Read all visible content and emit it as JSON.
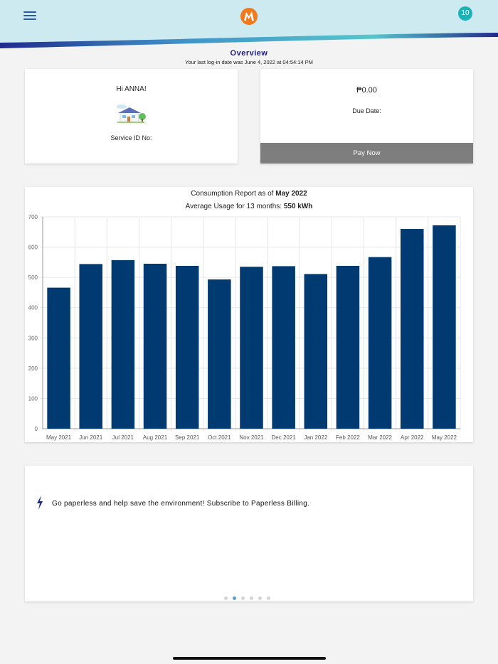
{
  "header": {
    "notification_count": "10",
    "icons": {
      "menu": "hamburger-menu-icon",
      "logo": "brand-logo-icon"
    },
    "colors": {
      "banner_bg": "#cdeaf0",
      "accent_teal": "#19b3b9",
      "navy": "#1f2a8c",
      "logo_orange": "#f07a1d"
    }
  },
  "overview": {
    "title": "Overview",
    "last_login": "Your last log-in date was June 4, 2022 at 04:54:14 PM"
  },
  "account_card": {
    "greeting": "Hi ANNA!",
    "house_icon": "house-illustration-icon",
    "service_id_label": "Service ID No:"
  },
  "billing_card": {
    "amount": "₱0.00",
    "due_date_label": "Due Date:",
    "pay_button": "Pay Now"
  },
  "consumption": {
    "title_prefix": "Consumption Report as of ",
    "title_date": "May 2022",
    "avg_prefix": "Average Usage for 13 months: ",
    "avg_value": "550 kWh"
  },
  "chart_data": {
    "type": "bar",
    "categories": [
      "May 2021",
      "Jun 2021",
      "Jul 2021",
      "Aug 2021",
      "Sep 2021",
      "Oct 2021",
      "Nov 2021",
      "Dec 2021",
      "Jan 2022",
      "Feb 2022",
      "Mar 2022",
      "Apr 2022",
      "May 2022"
    ],
    "values": [
      466,
      544,
      557,
      545,
      538,
      493,
      535,
      537,
      511,
      538,
      567,
      660,
      672
    ],
    "ylim": [
      0,
      700
    ],
    "yticks": [
      0,
      100,
      200,
      300,
      400,
      500,
      600,
      700
    ],
    "grid": true,
    "bar_color": "#003a70"
  },
  "promo": {
    "icon": "lightning-bolt-icon",
    "text": "Go paperless and help save the environment! Subscribe to Paperless Billing.",
    "carousel_pages": 6,
    "carousel_active": 1
  }
}
